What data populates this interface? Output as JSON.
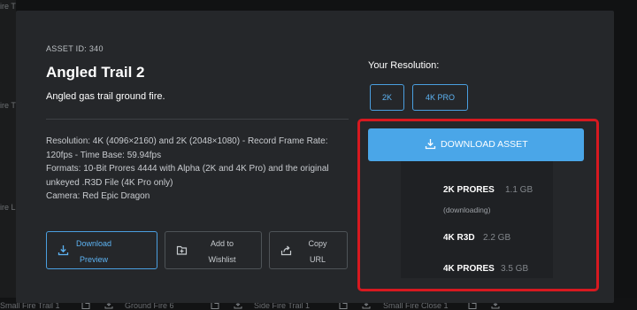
{
  "background": {
    "peek_labels": [
      "ire T",
      "ire T",
      "ire L"
    ],
    "thumbnails": [
      "Small Fire Trail 1",
      "Ground Fire 6",
      "Side Fire Trail 1",
      "Small Fire Close 1"
    ]
  },
  "asset": {
    "id_label": "ASSET ID: 340",
    "title": "Angled Trail 2",
    "description": "Angled gas trail ground fire.",
    "specs": [
      "Resolution: 4K (4096×2160) and 2K (2048×1080) - Record Frame Rate:",
      "120fps - Time Base: 59.94fps",
      "Formats: 10-Bit Prores 4444 with Alpha (2K and 4K Pro) and the original",
      "unkeyed .R3D File (4K Pro only)",
      "Camera: Red Epic Dragon"
    ]
  },
  "actions": {
    "download_preview": [
      "Download",
      "Preview"
    ],
    "add_to_wishlist": [
      "Add to",
      "Wishlist"
    ],
    "copy_url": [
      "Copy",
      "URL"
    ]
  },
  "resolution": {
    "label": "Your Resolution:",
    "options": [
      "2K",
      "4K PRO"
    ]
  },
  "download": {
    "button_label": "DOWNLOAD ASSET",
    "options": [
      {
        "name": "2K PRORES",
        "size": "1.1 GB",
        "note": "(downloading)"
      },
      {
        "name": "4K R3D",
        "size": "2.2 GB"
      },
      {
        "name": "4K PRORES",
        "size": "3.5 GB"
      }
    ]
  },
  "colors": {
    "accent": "#4aa6e8",
    "highlight": "#d71920",
    "modal_bg": "#25272a"
  },
  "icons": {
    "download": "download-icon",
    "wishlist": "folder-plus-icon",
    "share": "share-icon"
  }
}
